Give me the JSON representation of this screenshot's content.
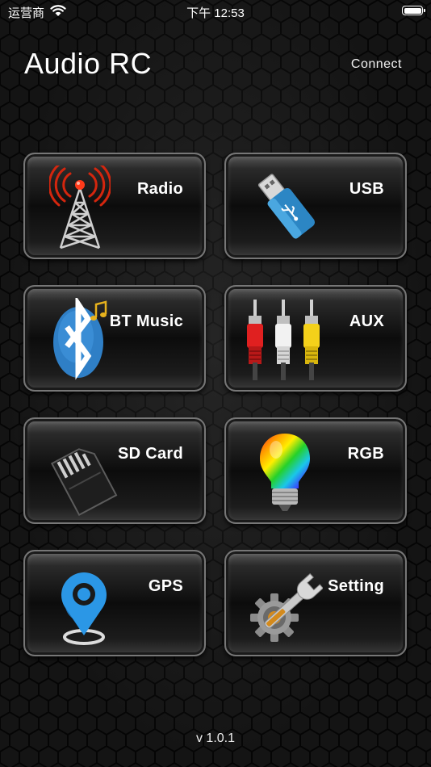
{
  "status_bar": {
    "carrier": "运营商",
    "time": "下午 12:53",
    "battery_level": 1.0
  },
  "header": {
    "title": "Audio RC",
    "connect_label": "Connect"
  },
  "tiles": [
    {
      "label": "Radio",
      "icon": "radio-tower-icon"
    },
    {
      "label": "USB",
      "icon": "usb-drive-icon"
    },
    {
      "label": "BT Music",
      "icon": "bluetooth-music-icon"
    },
    {
      "label": "AUX",
      "icon": "rca-cables-icon"
    },
    {
      "label": "SD Card",
      "icon": "sd-card-icon"
    },
    {
      "label": "RGB",
      "icon": "rgb-bulb-icon"
    },
    {
      "label": "GPS",
      "icon": "gps-pin-icon"
    },
    {
      "label": "Setting",
      "icon": "gear-wrench-icon"
    }
  ],
  "footer": {
    "version": "v 1.0.1"
  },
  "colors": {
    "background": "#141414",
    "tile_border": "#777777",
    "text": "#ffffff"
  }
}
